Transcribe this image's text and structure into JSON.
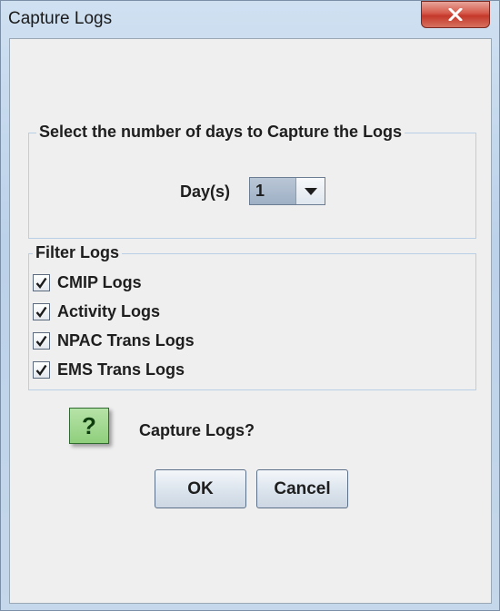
{
  "window": {
    "title": "Capture Logs"
  },
  "days_group": {
    "legend": "Select the number of days to Capture the Logs",
    "days_label": "Day(s)",
    "days_value": "1"
  },
  "filter_group": {
    "legend": "Filter Logs",
    "options": [
      {
        "label": "CMIP Logs",
        "checked": true
      },
      {
        "label": "Activity Logs",
        "checked": true
      },
      {
        "label": "NPAC Trans Logs",
        "checked": true
      },
      {
        "label": "EMS Trans Logs",
        "checked": true
      }
    ]
  },
  "prompt": {
    "icon": "question-icon",
    "icon_glyph": "?",
    "message": "Capture Logs?"
  },
  "buttons": {
    "ok_label": "OK",
    "cancel_label": "Cancel"
  },
  "colors": {
    "close_button": "#c4382a",
    "question_icon_bg": "#8fcf7c",
    "group_border": "#b8cfe5",
    "dialog_bg": "#efefef"
  }
}
